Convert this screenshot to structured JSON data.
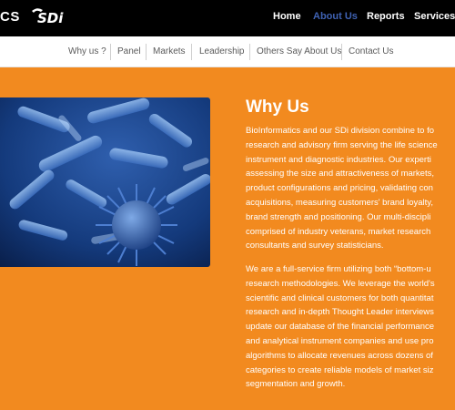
{
  "header": {
    "brand_fragment": "CS",
    "logo_text": "SDi",
    "nav": [
      {
        "label": "Home",
        "active": false
      },
      {
        "label": "About Us",
        "active": true
      },
      {
        "label": "Reports",
        "active": false
      },
      {
        "label": "Services",
        "active": false
      }
    ]
  },
  "subnav": {
    "items": [
      "Why us ?",
      "Panel",
      "Markets",
      "Leadership",
      "Others Say About Us",
      "Contact Us"
    ]
  },
  "main": {
    "title": "Why Us",
    "paragraph1_lines": [
      "BioInformatics and our SDi division combine to fo",
      "research and advisory firm serving the life science",
      "instrument and diagnostic industries. Our experti",
      "assessing the size and attractiveness of markets,",
      "product configurations and pricing, validating con",
      "acquisitions, measuring customers' brand loyalty,",
      "brand strength and positioning. Our multi-discipli",
      "comprised of industry veterans, market research",
      "consultants and survey statisticians."
    ],
    "paragraph2_lines": [
      "We are a full-service firm utilizing both “bottom-u",
      "research methodologies. We leverage the world's",
      "scientific and clinical customers for both quantitat",
      "research and in-depth Thought Leader interviews",
      "update our database of the financial performance",
      "and analytical instrument companies and use pro",
      "algorithms to allocate revenues across dozens of",
      "categories to create reliable models of market siz",
      "segmentation and growth."
    ]
  },
  "colors": {
    "header_bg": "#000000",
    "active_nav": "#3f62b3",
    "hero_bg": "#f28a1f",
    "text_white": "#ffffff"
  }
}
